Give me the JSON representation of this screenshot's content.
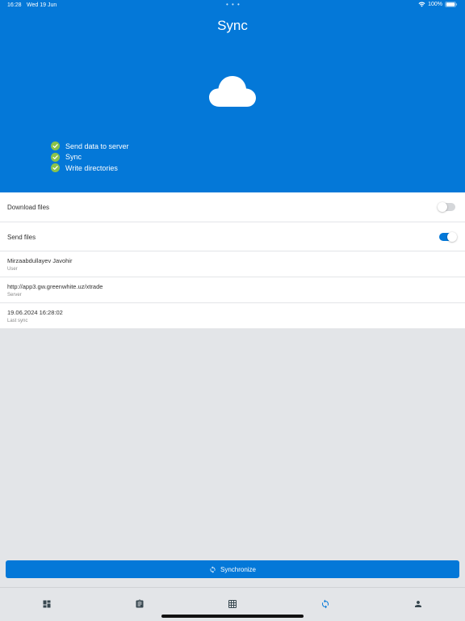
{
  "status_bar": {
    "time": "16:28",
    "date": "Wed 19 Jun",
    "battery": "100%"
  },
  "header": {
    "title": "Sync",
    "icon": "cloud-icon",
    "background_color": "#0478d8"
  },
  "steps": [
    {
      "label": "Send data to server",
      "status": "done"
    },
    {
      "label": "Sync",
      "status": "done"
    },
    {
      "label": "Write directories",
      "status": "done"
    }
  ],
  "settings": {
    "download_files": {
      "label": "Download files",
      "enabled": false
    },
    "send_files": {
      "label": "Send files",
      "enabled": true
    }
  },
  "info": [
    {
      "value": "Mirzaabdullayev Javohir",
      "caption": "User"
    },
    {
      "value": "http://app3.gw.greenwhite.uz/xtrade",
      "caption": "Server"
    },
    {
      "value": "19.06.2024 16:28:02",
      "caption": "Last sync"
    }
  ],
  "sync_button": {
    "label": "Synchronize",
    "icon": "refresh-icon"
  },
  "tabbar": {
    "active": "sync",
    "tabs": [
      {
        "id": "dashboard",
        "icon": "dashboard-icon"
      },
      {
        "id": "orders",
        "icon": "clipboard-icon"
      },
      {
        "id": "table",
        "icon": "grid-icon"
      },
      {
        "id": "sync",
        "icon": "sync-icon"
      },
      {
        "id": "profile",
        "icon": "person-icon"
      }
    ]
  },
  "colors": {
    "accent": "#0478d8",
    "check": "#8bc34a",
    "background": "#e3e5e8",
    "tab_inactive": "#37474f"
  }
}
